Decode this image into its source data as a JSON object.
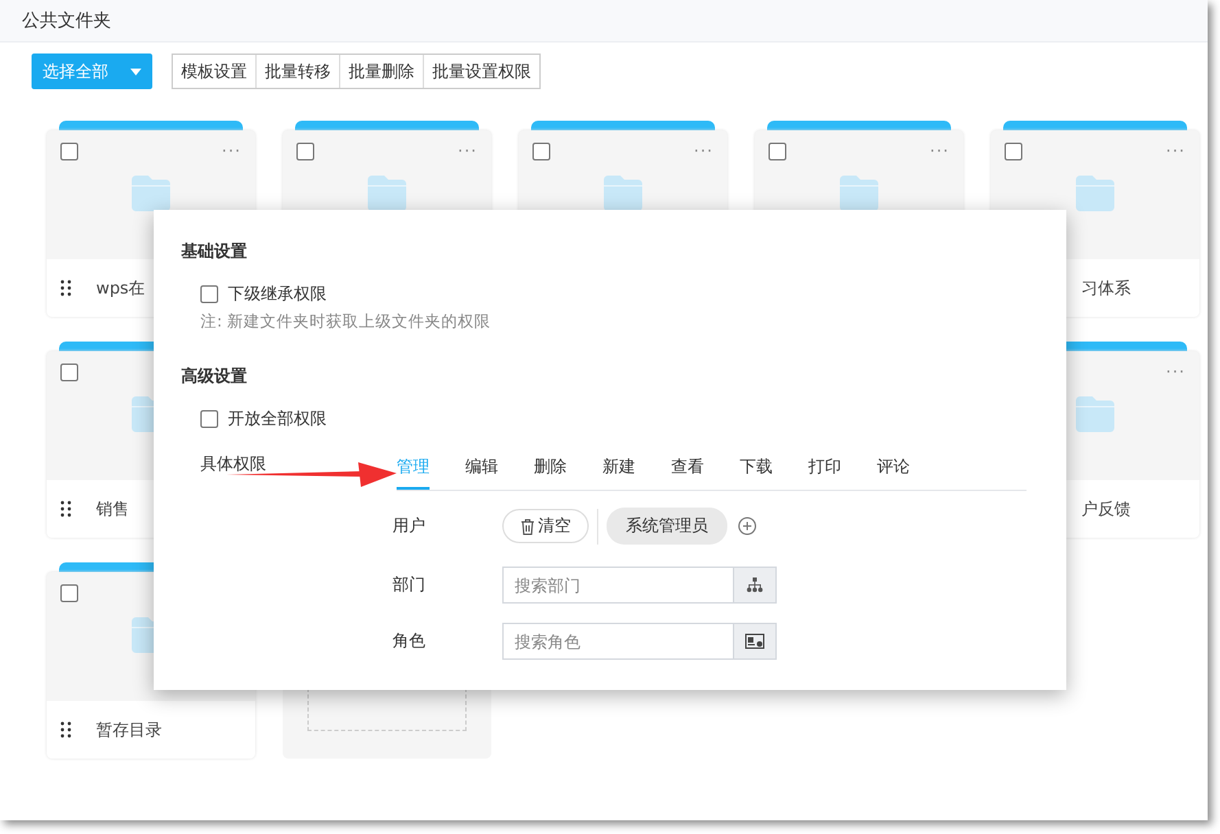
{
  "header": {
    "title": "公共文件夹"
  },
  "toolbar": {
    "select_all": {
      "label": "选择全部"
    },
    "buttons": [
      "模板设置",
      "批量转移",
      "批量删除",
      "批量设置权限"
    ]
  },
  "grid": [
    [
      {
        "kind": "folder",
        "checked": false,
        "more": "···",
        "name": "wps在"
      },
      {
        "kind": "folder",
        "checked": false,
        "more": "···"
      },
      {
        "kind": "folder",
        "checked": false,
        "more": "···"
      },
      {
        "kind": "folder",
        "checked": false,
        "more": "···"
      },
      {
        "kind": "folder",
        "checked": false,
        "more": "···",
        "name": "习体系"
      }
    ],
    [
      {
        "kind": "folder",
        "checked": false,
        "name": "销售"
      },
      {
        "kind": "covered"
      },
      {
        "kind": "covered"
      },
      {
        "kind": "covered"
      },
      {
        "kind": "folder",
        "more": "···",
        "name": "户反馈"
      }
    ],
    [
      {
        "kind": "folder",
        "checked": false,
        "name": "暂存目录"
      },
      {
        "kind": "add"
      }
    ]
  ],
  "dialog": {
    "basic": {
      "title": "基础设置",
      "option": {
        "label": "下级继承权限",
        "checked": false
      },
      "note": "注: 新建文件夹时获取上级文件夹的权限"
    },
    "advanced": {
      "title": "高级设置",
      "option": {
        "label": "开放全部权限",
        "checked": false
      }
    },
    "permissions": {
      "label": "具体权限",
      "tabs": [
        {
          "label": "管理",
          "selected": true
        },
        {
          "label": "编辑",
          "selected": false
        },
        {
          "label": "删除",
          "selected": false
        },
        {
          "label": "新建",
          "selected": false
        },
        {
          "label": "查看",
          "selected": false
        },
        {
          "label": "下载",
          "selected": false
        },
        {
          "label": "打印",
          "selected": false
        },
        {
          "label": "评论",
          "selected": false
        }
      ],
      "user": {
        "label": "用户",
        "clear": "清空",
        "tags": [
          "系统管理员"
        ]
      },
      "department": {
        "label": "部门",
        "placeholder": "搜索部门"
      },
      "role": {
        "label": "角色",
        "placeholder": "搜索角色"
      }
    }
  }
}
